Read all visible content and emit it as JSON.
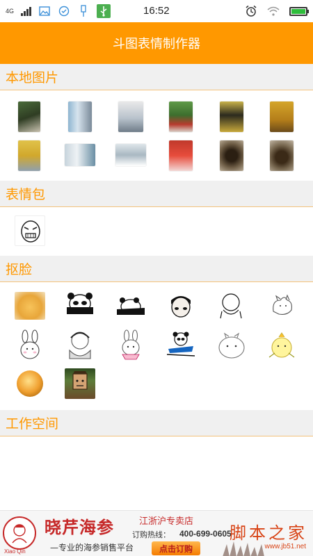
{
  "status_bar": {
    "network": "4G",
    "time": "16:52",
    "icons": [
      "signal-icon",
      "gallery-icon",
      "check-circle-icon",
      "usb-icon",
      "usb-debug-icon",
      "alarm-icon",
      "wifi-icon",
      "battery-icon"
    ]
  },
  "app": {
    "title": "斗图表情制作器",
    "accent_color": "#ff9800"
  },
  "sections": {
    "local": {
      "title": "本地图片"
    },
    "emoji": {
      "title": "表情包"
    },
    "cutout": {
      "title": "抠脸"
    },
    "workspace": {
      "title": "工作空间"
    }
  },
  "local_images": [
    "plant-photo",
    "water-bottle-photo",
    "room-photo",
    "cactus-photo",
    "tea-package-photo",
    "gold-tin-photo",
    "yellow-box-photo",
    "document-photo",
    "monitor-photo",
    "red-box-photo",
    "tea-cup-photo",
    "tea-bowl-photo"
  ],
  "emoji_packs": [
    "rage-face-sticker"
  ],
  "cutout_images": [
    "cat-sticker",
    "panda-sticker",
    "panda-lying-sticker",
    "bowl-cut-sticker",
    "round-head-sticker",
    "cat-doodle-sticker",
    "rabbit-sticker",
    "panda-hug-sticker",
    "rabbit-face-sticker",
    "panda-stretch-sticker",
    "white-blob-sticker",
    "yellow-bird-sticker",
    "orange-ball-sticker",
    "cartoon-face-sticker"
  ],
  "ad": {
    "brand": "晓芹海参",
    "slogan": "—专业的海参销售平台",
    "region": "江浙沪专卖店",
    "hotline_label": "订购热线：",
    "hotline": "400-699-0605",
    "cta": "点击订购",
    "logo_text": "Xiao Qin"
  },
  "watermark": {
    "text": "脚本之家",
    "url": "www.jb51.net"
  }
}
